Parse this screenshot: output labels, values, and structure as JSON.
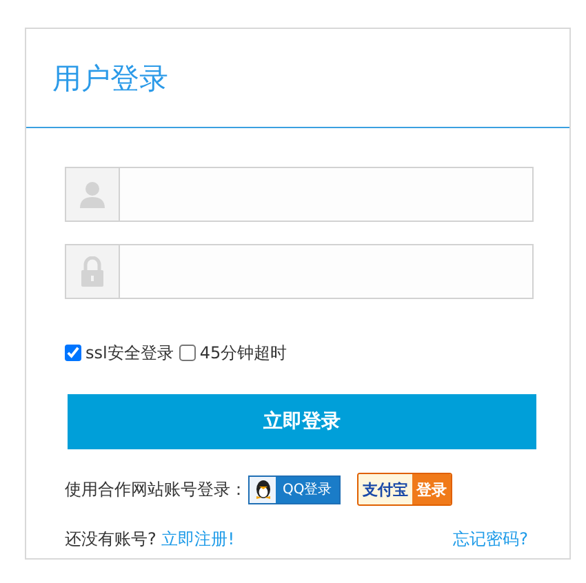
{
  "panel": {
    "title": "用户登录"
  },
  "fields": [
    {
      "kind": "user"
    },
    {
      "kind": "lock"
    }
  ],
  "options": [
    {
      "label": "ssl安全登录",
      "checked": true
    },
    {
      "label": "45分钟超时",
      "checked": false
    }
  ],
  "submit": {
    "label": "立即登录"
  },
  "partners": {
    "label": "使用合作网站账号登录：",
    "badges": [
      {
        "kind": "qq",
        "label": "QQ登录"
      },
      {
        "kind": "alipay",
        "brand": "支付宝",
        "label": "登录"
      }
    ]
  },
  "footer": {
    "prompt": "还没有账号?",
    "register": "立即注册!",
    "forgot": "忘记密码?"
  }
}
